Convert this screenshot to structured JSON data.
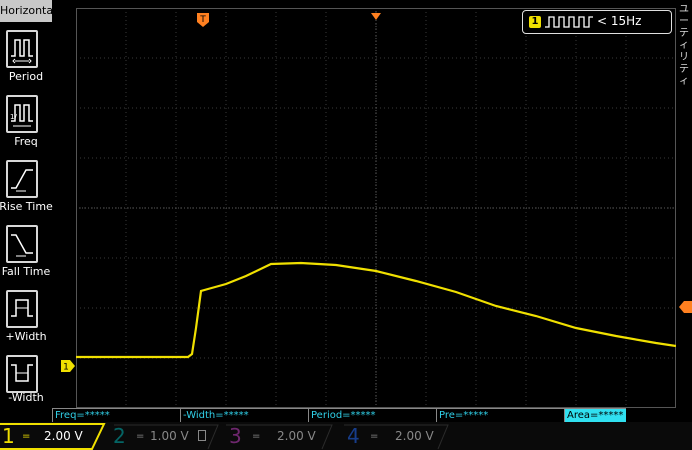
{
  "sidebar": {
    "title": "Horizontal",
    "items": [
      {
        "label": "Period",
        "icon": "period-icon"
      },
      {
        "label": "Freq",
        "icon": "freq-icon"
      },
      {
        "label": "Rise Time",
        "icon": "rise-time-icon"
      },
      {
        "label": "Fall Time",
        "icon": "fall-time-icon"
      },
      {
        "label": "+Width",
        "icon": "positive-width-icon"
      },
      {
        "label": "-Width",
        "icon": "negative-width-icon"
      }
    ]
  },
  "right_panel": {
    "text": "ユーティリティ"
  },
  "trigger_freq": {
    "channel": "1",
    "text": "< 15Hz"
  },
  "markers": {
    "trigger": "T",
    "channel1": "1"
  },
  "measurements": [
    {
      "label": "Freq=*****",
      "highlight": false
    },
    {
      "label": "-Width=*****",
      "highlight": false
    },
    {
      "label": "Period=*****",
      "highlight": false
    },
    {
      "label": "Pre=*****",
      "highlight": false
    },
    {
      "label": "Area=*****",
      "highlight": true
    }
  ],
  "channels": [
    {
      "num": "1",
      "coupling": "=",
      "volt": "2.00 V",
      "active": true,
      "color": "#f0e000"
    },
    {
      "num": "2",
      "coupling": "=",
      "volt": "1.00 V",
      "active": false,
      "color": "#00b0b0"
    },
    {
      "num": "3",
      "coupling": "=",
      "volt": "2.00 V",
      "active": false,
      "color": "#c040c0"
    },
    {
      "num": "4",
      "coupling": "=",
      "volt": "2.00 V",
      "active": false,
      "color": "#2060e0"
    }
  ],
  "colors": {
    "trace": "#f0e000",
    "trigger_marker": "#ff8020",
    "meas_highlight": "#30e0f0"
  }
}
